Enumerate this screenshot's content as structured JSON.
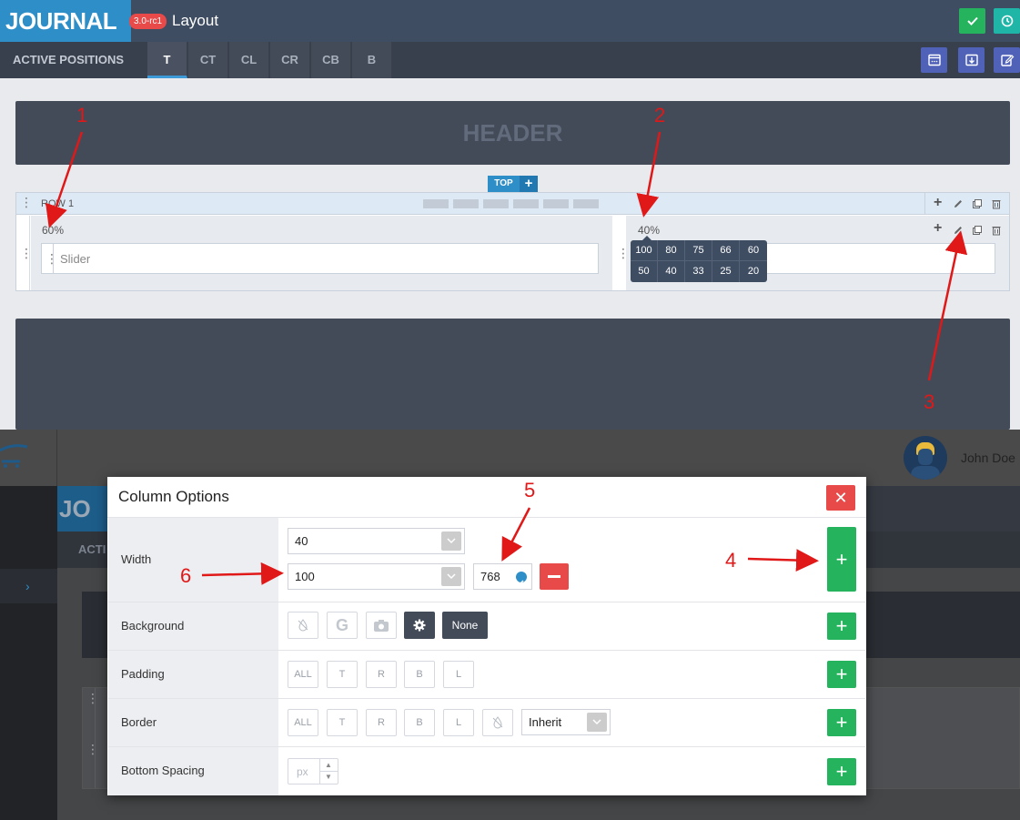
{
  "app": {
    "logo": "JOURNAL",
    "version": "3.0-rc1",
    "title": "Layout"
  },
  "positions": {
    "label": "ACTIVE POSITIONS",
    "tabs": [
      "T",
      "CT",
      "CL",
      "CR",
      "CB",
      "B"
    ],
    "active_tab": "T"
  },
  "canvas": {
    "header_label": "HEADER",
    "top_badge": "TOP",
    "row_label": "ROW 1",
    "col1_width": "60%",
    "col2_width": "40%",
    "module_label": "Slider",
    "width_options": [
      "100",
      "80",
      "75",
      "66",
      "60",
      "50",
      "40",
      "33",
      "25",
      "20"
    ]
  },
  "background_app": {
    "user_name": "John Doe",
    "logo_partial": "JO",
    "tab_partial": "ACTI"
  },
  "modal": {
    "title": "Column Options",
    "rows": {
      "width": "Width",
      "background": "Background",
      "padding": "Padding",
      "border": "Border",
      "bottom_spacing": "Bottom Spacing"
    },
    "width_value": "40",
    "width_responsive_value": "100",
    "breakpoint_value": "768",
    "background_none": "None",
    "side_buttons": [
      "ALL",
      "T",
      "R",
      "B",
      "L"
    ],
    "border_style": "Inherit",
    "unit_placeholder": "px"
  },
  "annotations": [
    "1",
    "2",
    "3",
    "4",
    "5",
    "6"
  ],
  "colors": {
    "accent_green": "#25b35d",
    "danger_red": "#e84a4a",
    "brand_blue": "#2d8ec8",
    "annotation_red": "#e01818"
  }
}
